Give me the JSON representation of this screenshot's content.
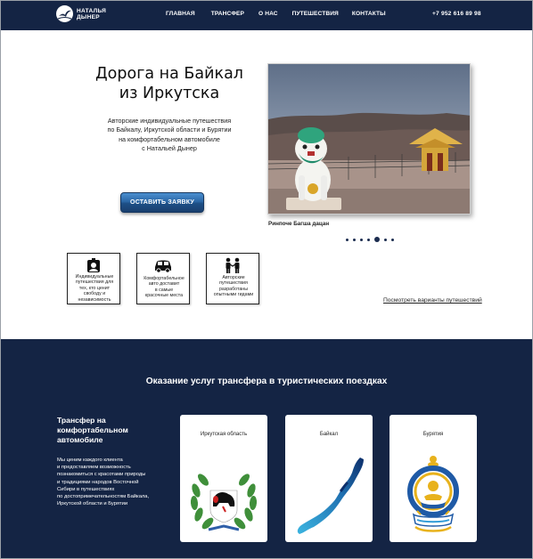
{
  "header": {
    "logo_line1": "НАТАЛЬЯ",
    "logo_line2": "ДЫНЕР",
    "nav": [
      "ГЛАВНАЯ",
      "ТРАНСФЕР",
      "О НАС",
      "ПУТЕШЕСТВИЯ",
      "КОНТАКТЫ"
    ],
    "phone": "+7 952 616 89 98"
  },
  "hero": {
    "title_line1": "Дорога на Байкал",
    "title_line2": "из Иркутска",
    "subtitle_lines": [
      "Авторские индивидуальные путешествия",
      "по Байкалу, Иркутской области и Бурятии",
      "на комфортабельном автомобиле",
      "с Натальей Дынер"
    ],
    "cta_label": "ОСТАВИТЬ ЗАЯВКУ"
  },
  "slider": {
    "caption": "Ринпоче Багша дацан",
    "dot_count": 6,
    "active_index": 4
  },
  "features": [
    {
      "icon": "person-badge-icon",
      "lines": [
        "Индивидуальные",
        "путешествия для",
        "тех, кто ценит",
        "свободу и",
        "независимость"
      ]
    },
    {
      "icon": "car-icon",
      "lines": [
        "Комфортабельное",
        "авто доставит",
        "в самые",
        "красочные места"
      ]
    },
    {
      "icon": "guides-icon",
      "lines": [
        "Авторские",
        "путешествия",
        "разработаны",
        "опытными гидами"
      ]
    }
  ],
  "trips_link": "Посмотреть варианты путешествий",
  "transfer": {
    "section_title": "Оказание услуг трансфера в туристических поездках",
    "heading_lines": [
      "Трансфер на",
      "комфортабельном",
      "автомобиле"
    ],
    "text_lines": [
      "Мы ценим каждого клиента",
      "и предоставляем возможность",
      "познакомиться с красотами природы",
      "и традициями народов Восточной",
      "Сибири в путешествиях",
      "по достопримечательностям Байкала,",
      "Иркутской области и Бурятии"
    ],
    "cards": [
      {
        "title": "Иркутская область",
        "icon": "irkutsk-coat-of-arms-icon"
      },
      {
        "title": "Байкал",
        "icon": "baikal-lake-map-icon"
      },
      {
        "title": "Бурятия",
        "icon": "buryatia-coat-of-arms-icon"
      }
    ]
  },
  "colors": {
    "navy": "#142444",
    "button_blue": "#2b67a6",
    "white": "#ffffff"
  }
}
